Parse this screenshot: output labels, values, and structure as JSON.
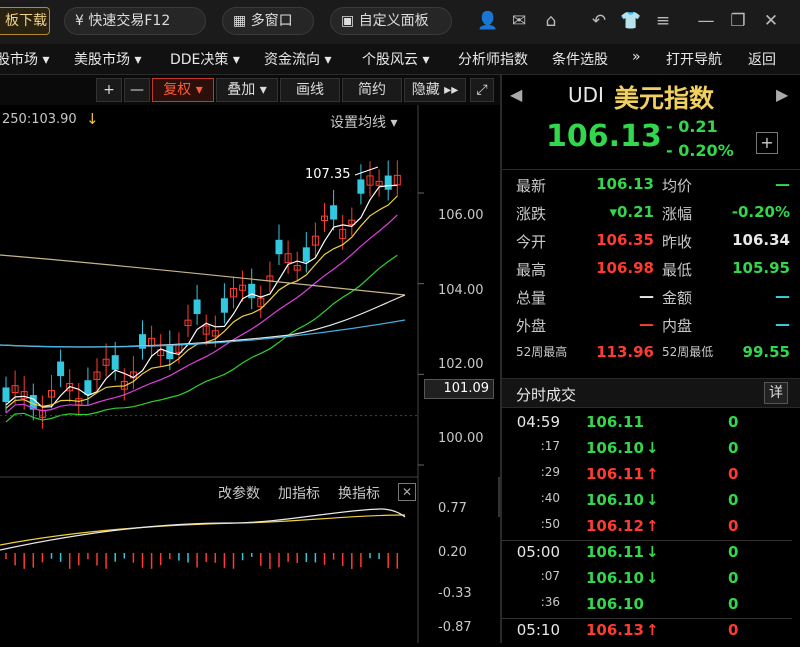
{
  "toolbar": {
    "download": "板下载",
    "fast_trade": "快速交易F12",
    "multi_window": "多窗口",
    "custom_panel": "自定义面板"
  },
  "menu": [
    "股市场 ▾",
    "美股市场 ▾",
    "DDE决策 ▾",
    "资金流向 ▾",
    "个股风云 ▾",
    "分析师指数",
    "条件选股",
    "»",
    "打开导航",
    "返回"
  ],
  "chart_toolbar": {
    "plus": "+",
    "minus": "—",
    "fuquan": "复权 ▾",
    "overlay": "叠加 ▾",
    "draw": "画线",
    "simple": "简约",
    "hide": "隐藏 ▸▸"
  },
  "chart": {
    "ma_label": "250:103.90",
    "ma_arrow": "↓",
    "settings": "设置均线 ▾",
    "high_label": "107.35",
    "yaxis": [
      "106.00",
      "104.00",
      "102.00",
      "101.09",
      "100.00"
    ],
    "lower_links": [
      "改参数",
      "加指标",
      "换指标"
    ],
    "lower_yaxis": [
      "0.77",
      "0.20",
      "-0.33",
      "-0.87"
    ]
  },
  "chart_data": {
    "type": "candlestick",
    "yaxis": {
      "min": 100.0,
      "max": 107.5,
      "ticks": [
        100.0,
        102.0,
        104.0,
        106.0
      ]
    },
    "current_price": 101.09,
    "highlight_high": 107.35
  },
  "quote": {
    "code": "UDI",
    "name": "美元指数",
    "price": "106.13",
    "change": "- 0.21",
    "pct": "- 0.20%",
    "rows": [
      {
        "l1": "最新",
        "v1": "106.13",
        "c1": "green",
        "l2": "均价",
        "v2": "—",
        "c2": "green"
      },
      {
        "l1": "涨跌",
        "v1": "▾0.21",
        "c1": "green",
        "l2": "涨幅",
        "v2": "-0.20%",
        "c2": "green"
      },
      {
        "l1": "今开",
        "v1": "106.35",
        "c1": "red",
        "l2": "昨收",
        "v2": "106.34",
        "c2": "white"
      },
      {
        "l1": "最高",
        "v1": "106.98",
        "c1": "red",
        "l2": "最低",
        "v2": "105.95",
        "c2": "green"
      },
      {
        "l1": "总量",
        "v1": "—",
        "c1": "white",
        "l2": "金额",
        "v2": "—",
        "c2": "cyan"
      },
      {
        "l1": "外盘",
        "v1": "—",
        "c1": "red",
        "l2": "内盘",
        "v2": "—",
        "c2": "cyan"
      },
      {
        "l1": "52周最高",
        "v1": "113.96",
        "c1": "red",
        "l2": "52周最低",
        "v2": "99.55",
        "c2": "green"
      }
    ]
  },
  "ticks_header": "分时成交",
  "ticks_detail": "详",
  "ticks": [
    {
      "t": "04:59",
      "p": "106.11",
      "a": "",
      "c": "green",
      "v": "0"
    },
    {
      "t": ":17",
      "p": "106.10",
      "a": "↓",
      "c": "green",
      "v": "0"
    },
    {
      "t": ":29",
      "p": "106.11",
      "a": "↑",
      "c": "red",
      "v": "0"
    },
    {
      "t": ":40",
      "p": "106.10",
      "a": "↓",
      "c": "green",
      "v": "0"
    },
    {
      "t": ":50",
      "p": "106.12",
      "a": "↑",
      "c": "red",
      "v": "0"
    },
    {
      "t": "05:00",
      "p": "106.11",
      "a": "↓",
      "c": "green",
      "v": "0"
    },
    {
      "t": ":07",
      "p": "106.10",
      "a": "↓",
      "c": "green",
      "v": "0"
    },
    {
      "t": ":36",
      "p": "106.10",
      "a": "",
      "c": "green",
      "v": "0"
    },
    {
      "t": "05:10",
      "p": "106.13",
      "a": "↑",
      "c": "red",
      "v": "0"
    }
  ]
}
